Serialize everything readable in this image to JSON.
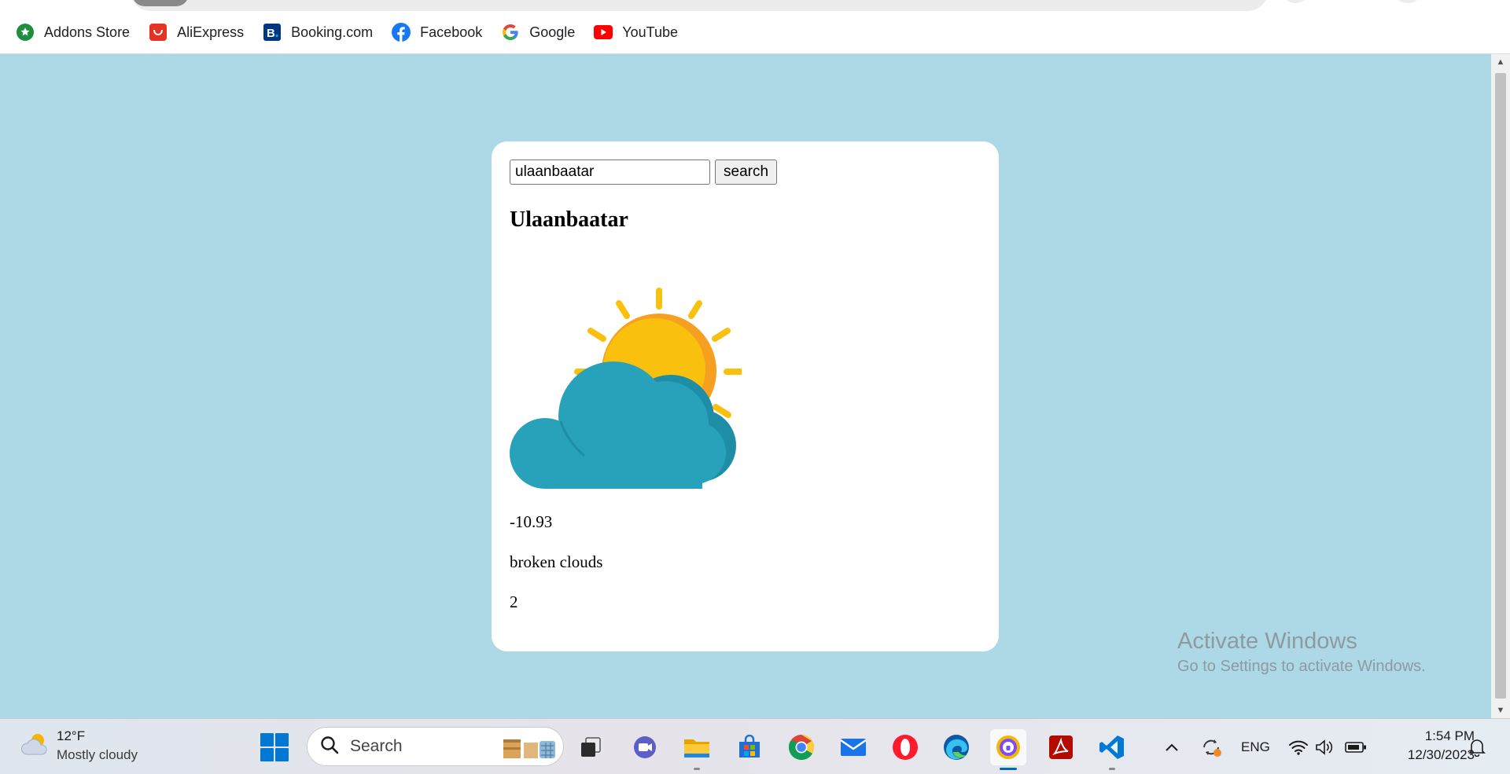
{
  "browser": {
    "bookmarks": [
      {
        "label": "Addons Store",
        "icon": "addons-store-icon",
        "color": "#1e8e3e"
      },
      {
        "label": "AliExpress",
        "icon": "aliexpress-icon",
        "color": "#e43225"
      },
      {
        "label": "Booking.com",
        "icon": "booking-icon",
        "color": "#003580"
      },
      {
        "label": "Facebook",
        "icon": "facebook-icon",
        "color": "#1877f2"
      },
      {
        "label": "Google",
        "icon": "google-icon",
        "color": "#4285f4"
      },
      {
        "label": "YouTube",
        "icon": "youtube-icon",
        "color": "#ff0000"
      }
    ]
  },
  "app": {
    "search": {
      "value": "ulaanbaatar",
      "button_label": "search"
    },
    "city": "Ulaanbaatar",
    "weather_icon": "sun-behind-cloud-icon",
    "temperature": "-10.93",
    "description": "broken clouds",
    "extra_value": "2",
    "colors": {
      "background": "#add8e6",
      "card": "#ffffff",
      "sun": "#f9c10e",
      "cloud": "#27a2ba"
    }
  },
  "watermark": {
    "title": "Activate Windows",
    "subtitle": "Go to Settings to activate Windows."
  },
  "taskbar": {
    "weather": {
      "temp": "12°F",
      "condition": "Mostly cloudy"
    },
    "search_placeholder": "Search",
    "apps": [
      "start-icon",
      "task-view-icon",
      "teams-meet-icon",
      "file-explorer-icon",
      "microsoft-store-icon",
      "chrome-icon",
      "mail-icon",
      "opera-icon",
      "edge-icon",
      "vpn-icon",
      "acrobat-icon",
      "vscode-icon"
    ],
    "tray": {
      "language": "ENG"
    },
    "clock": {
      "time": "1:54 PM",
      "date": "12/30/2023"
    }
  }
}
